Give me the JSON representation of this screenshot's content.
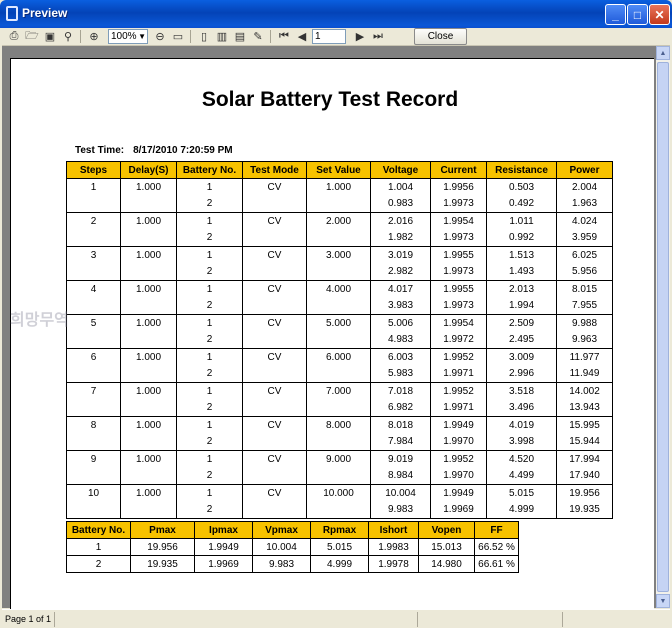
{
  "window": {
    "title": "Preview"
  },
  "toolbar": {
    "zoom": "100%",
    "page": "1",
    "close_label": "Close"
  },
  "report": {
    "title": "Solar Battery Test Record",
    "test_time_label": "Test Time:",
    "test_time_value": "8/17/2010 7:20:59 PM"
  },
  "main_table": {
    "headers": [
      "Steps",
      "Delay(S)",
      "Battery No.",
      "Test Mode",
      "Set Value",
      "Voltage",
      "Current",
      "Resistance",
      "Power"
    ],
    "rows": [
      [
        "1",
        "1.000",
        "1",
        "CV",
        "1.000",
        "1.004",
        "1.9956",
        "0.503",
        "2.004"
      ],
      [
        "",
        "",
        "2",
        "",
        "",
        "0.983",
        "1.9973",
        "0.492",
        "1.963"
      ],
      [
        "2",
        "1.000",
        "1",
        "CV",
        "2.000",
        "2.016",
        "1.9954",
        "1.011",
        "4.024"
      ],
      [
        "",
        "",
        "2",
        "",
        "",
        "1.982",
        "1.9973",
        "0.992",
        "3.959"
      ],
      [
        "3",
        "1.000",
        "1",
        "CV",
        "3.000",
        "3.019",
        "1.9955",
        "1.513",
        "6.025"
      ],
      [
        "",
        "",
        "2",
        "",
        "",
        "2.982",
        "1.9973",
        "1.493",
        "5.956"
      ],
      [
        "4",
        "1.000",
        "1",
        "CV",
        "4.000",
        "4.017",
        "1.9955",
        "2.013",
        "8.015"
      ],
      [
        "",
        "",
        "2",
        "",
        "",
        "3.983",
        "1.9973",
        "1.994",
        "7.955"
      ],
      [
        "5",
        "1.000",
        "1",
        "CV",
        "5.000",
        "5.006",
        "1.9954",
        "2.509",
        "9.988"
      ],
      [
        "",
        "",
        "2",
        "",
        "",
        "4.983",
        "1.9972",
        "2.495",
        "9.963"
      ],
      [
        "6",
        "1.000",
        "1",
        "CV",
        "6.000",
        "6.003",
        "1.9952",
        "3.009",
        "11.977"
      ],
      [
        "",
        "",
        "2",
        "",
        "",
        "5.983",
        "1.9971",
        "2.996",
        "11.949"
      ],
      [
        "7",
        "1.000",
        "1",
        "CV",
        "7.000",
        "7.018",
        "1.9952",
        "3.518",
        "14.002"
      ],
      [
        "",
        "",
        "2",
        "",
        "",
        "6.982",
        "1.9971",
        "3.496",
        "13.943"
      ],
      [
        "8",
        "1.000",
        "1",
        "CV",
        "8.000",
        "8.018",
        "1.9949",
        "4.019",
        "15.995"
      ],
      [
        "",
        "",
        "2",
        "",
        "",
        "7.984",
        "1.9970",
        "3.998",
        "15.944"
      ],
      [
        "9",
        "1.000",
        "1",
        "CV",
        "9.000",
        "9.019",
        "1.9952",
        "4.520",
        "17.994"
      ],
      [
        "",
        "",
        "2",
        "",
        "",
        "8.984",
        "1.9970",
        "4.499",
        "17.940"
      ],
      [
        "10",
        "1.000",
        "1",
        "CV",
        "10.000",
        "10.004",
        "1.9949",
        "5.015",
        "19.956"
      ],
      [
        "",
        "",
        "2",
        "",
        "",
        "9.983",
        "1.9969",
        "4.999",
        "19.935"
      ]
    ]
  },
  "summary_table": {
    "headers": [
      "Battery No.",
      "Pmax",
      "Ipmax",
      "Vpmax",
      "Rpmax",
      "Ishort",
      "Vopen",
      "FF"
    ],
    "rows": [
      [
        "1",
        "19.956",
        "1.9949",
        "10.004",
        "5.015",
        "1.9983",
        "15.013",
        "66.52 %"
      ],
      [
        "2",
        "19.935",
        "1.9969",
        "9.983",
        "4.999",
        "1.9978",
        "14.980",
        "66.61 %"
      ]
    ]
  },
  "watermark": "희망무역",
  "status": {
    "page_text": "Page 1 of 1"
  }
}
